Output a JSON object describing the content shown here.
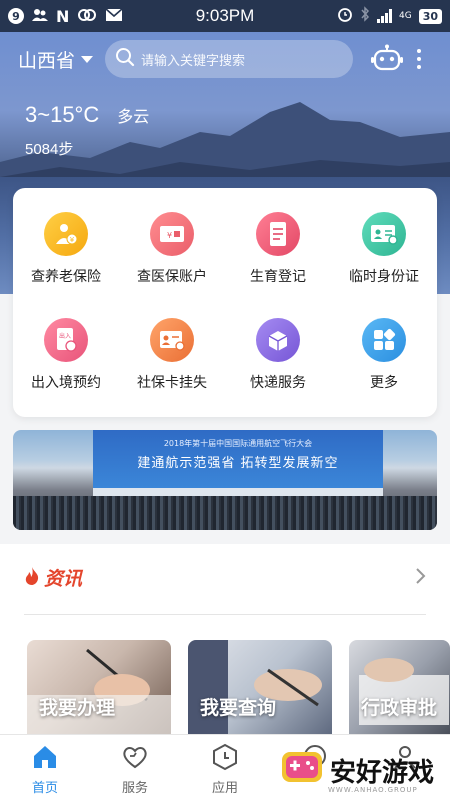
{
  "status_bar": {
    "notification_count": "9",
    "time": "9:03PM",
    "network": "4G",
    "battery": "30"
  },
  "header": {
    "province": "山西省",
    "search_placeholder": "请输入关键字搜索"
  },
  "weather": {
    "temperature": "3~15°C",
    "condition": "多云",
    "steps": "5084步"
  },
  "services": [
    {
      "label": "查养老保险",
      "icon": "pension-icon",
      "color": "#f5b820"
    },
    {
      "label": "查医保账户",
      "icon": "medical-card-icon",
      "color": "#f0707a"
    },
    {
      "label": "生育登记",
      "icon": "document-icon",
      "color": "#ec5f78"
    },
    {
      "label": "临时身份证",
      "icon": "id-card-icon",
      "color": "#45c7a8"
    },
    {
      "label": "出入境预约",
      "icon": "passport-icon",
      "color": "#f06a86"
    },
    {
      "label": "社保卡挂失",
      "icon": "social-card-icon",
      "color": "#f28a4e"
    },
    {
      "label": "快递服务",
      "icon": "parcel-icon",
      "color": "#8b6fe0"
    },
    {
      "label": "更多",
      "icon": "grid-more-icon",
      "color": "#3ba1ea"
    }
  ],
  "banner": {
    "small_text": "2018年第十届中国国际通用航空飞行大会",
    "title": "建通航示范强省  拓转型发展新空"
  },
  "news": {
    "title": "资讯",
    "tiles": [
      {
        "label": "我要办理"
      },
      {
        "label": "我要查询"
      },
      {
        "label": "行政审批"
      }
    ]
  },
  "tabs": [
    {
      "label": "首页",
      "icon": "home-icon",
      "active": true
    },
    {
      "label": "服务",
      "icon": "heart-service-icon",
      "active": false
    },
    {
      "label": "应用",
      "icon": "clock-hexagon-icon",
      "active": false
    },
    {
      "label": "",
      "icon": "chat-icon",
      "active": false
    },
    {
      "label": "",
      "icon": "profile-icon",
      "active": false
    }
  ],
  "watermark": {
    "text": "安好游戏",
    "subtext": "WWW.ANHAO.GROUP"
  },
  "colors": {
    "accent": "#2a8ce6",
    "news_red": "#e4452c",
    "status_bg": "#263550"
  }
}
